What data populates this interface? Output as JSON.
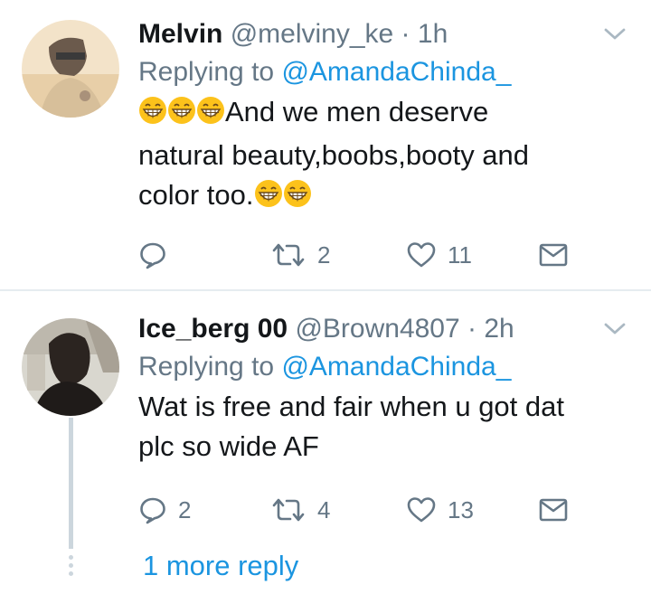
{
  "tweets": [
    {
      "name": "Melvin",
      "handle": "@melviny_ke",
      "dot": " · ",
      "time": "1h",
      "replying_prefix": "Replying to ",
      "replying_to": "@AmandaChinda_",
      "text_line1": "And we men deserve",
      "text_line2": "natural beauty,boobs,booty and",
      "text_line3": "color too.",
      "reply_count": "",
      "retweet_count": "2",
      "like_count": "11"
    },
    {
      "name": "Ice_berg 00",
      "handle": "@Brown4807",
      "dot": " · ",
      "time": "2h",
      "replying_prefix": "Replying to ",
      "replying_to": "@AmandaChinda_",
      "text_line1": "Wat is free and fair when u got dat",
      "text_line2": "plc so wide AF",
      "reply_count": "2",
      "retweet_count": "4",
      "like_count": "13"
    }
  ],
  "more_replies": "1 more reply",
  "colors": {
    "link": "#1b95e0",
    "muted": "#657786",
    "text": "#14171a",
    "divider": "#e6ecf0",
    "emoji": "#fcc21b"
  },
  "icons": [
    "chevron-down-icon",
    "reply-icon",
    "retweet-icon",
    "heart-icon",
    "direct-message-icon",
    "grinning-emoji-icon"
  ]
}
